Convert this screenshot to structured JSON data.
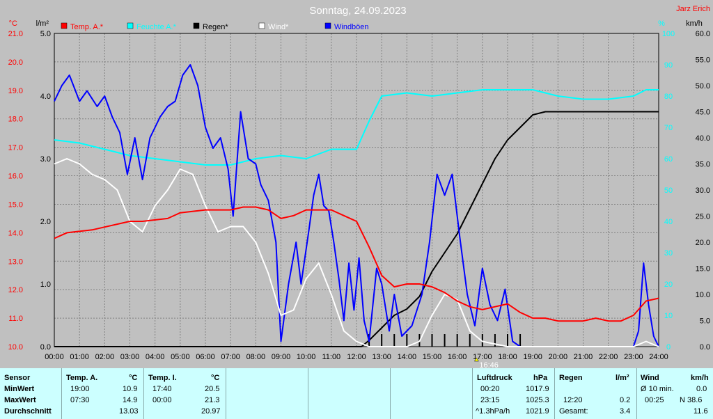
{
  "title": "Sonntag, 24.09.2023",
  "station": "Jarz Erich",
  "colors": {
    "temp_a": "#ff0000",
    "temp_i": "#00ffff",
    "rain": "#000000",
    "wind": "#ffffff",
    "gust": "#0000ff",
    "bg": "#c0c0c0",
    "grid": "#808080",
    "table_bg": "#ccffff"
  },
  "legend": [
    {
      "label": "Temp. A.*",
      "color": "#ff0000"
    },
    {
      "label": "Feuchte A.*",
      "color": "#00ffff"
    },
    {
      "label": "Regen*",
      "color": "#000000"
    },
    {
      "label": "Wind*",
      "color": "#ffffff"
    },
    {
      "label": "Windböen",
      "color": "#0000ff"
    }
  ],
  "axes": {
    "temp_unit": "°C",
    "rain_unit": "l/m²",
    "hum_unit": "%",
    "wind_unit": "km/h",
    "temp_ticks": [
      "21.0",
      "20.0",
      "19.0",
      "18.0",
      "17.0",
      "16.0",
      "15.0",
      "14.0",
      "13.0",
      "12.0",
      "11.0",
      "10.0"
    ],
    "rain_ticks": [
      "5.0",
      "4.0",
      "3.0",
      "2.0",
      "1.0",
      "0.0"
    ],
    "hum_ticks": [
      "100",
      "90",
      "80",
      "70",
      "60",
      "50",
      "40",
      "30",
      "20",
      "10",
      "0"
    ],
    "wind_ticks": [
      "60.0",
      "55.0",
      "50.0",
      "45.0",
      "40.0",
      "35.0",
      "30.0",
      "25.0",
      "20.0",
      "15.0",
      "10.0",
      "5.0",
      "0.0"
    ],
    "x_ticks": [
      "00:00",
      "01:00",
      "02:00",
      "03:00",
      "04:00",
      "05:00",
      "06:00",
      "07:00",
      "08:00",
      "09:00",
      "10:00",
      "11:00",
      "12:00",
      "13:00",
      "14:00",
      "15:00",
      "16:00",
      "17:00",
      "18:00",
      "19:00",
      "20:00",
      "21:00",
      "22:00",
      "23:00",
      "24:00"
    ],
    "marker_label": "16:46"
  },
  "chart_data": {
    "type": "line",
    "x_unit": "hour",
    "series": [
      {
        "name": "Temp. A.*",
        "unit": "°C",
        "points": [
          [
            0,
            13.8
          ],
          [
            0.5,
            14.0
          ],
          [
            1.5,
            14.1
          ],
          [
            2,
            14.2
          ],
          [
            3,
            14.4
          ],
          [
            3.5,
            14.4
          ],
          [
            4.5,
            14.5
          ],
          [
            5,
            14.7
          ],
          [
            6,
            14.8
          ],
          [
            7,
            14.8
          ],
          [
            7.5,
            14.9
          ],
          [
            8,
            14.9
          ],
          [
            8.5,
            14.8
          ],
          [
            9,
            14.5
          ],
          [
            9.5,
            14.6
          ],
          [
            10,
            14.8
          ],
          [
            10.5,
            14.8
          ],
          [
            11,
            14.8
          ],
          [
            11.5,
            14.6
          ],
          [
            12,
            14.4
          ],
          [
            12.5,
            13.5
          ],
          [
            13,
            12.5
          ],
          [
            13.5,
            12.1
          ],
          [
            14,
            12.2
          ],
          [
            14.5,
            12.2
          ],
          [
            15,
            12.1
          ],
          [
            15.5,
            11.9
          ],
          [
            16,
            11.6
          ],
          [
            16.5,
            11.4
          ],
          [
            17,
            11.3
          ],
          [
            17.5,
            11.4
          ],
          [
            18,
            11.5
          ],
          [
            18.5,
            11.2
          ],
          [
            19,
            11.0
          ],
          [
            19.5,
            11.0
          ],
          [
            20,
            10.9
          ],
          [
            21,
            10.9
          ],
          [
            21.5,
            11.0
          ],
          [
            22,
            10.9
          ],
          [
            22.5,
            10.9
          ],
          [
            23,
            11.1
          ],
          [
            23.5,
            11.6
          ],
          [
            24,
            11.7
          ]
        ]
      },
      {
        "name": "Feuchte A.*",
        "unit": "%",
        "points": [
          [
            0,
            66
          ],
          [
            1,
            65
          ],
          [
            2,
            63
          ],
          [
            3,
            61
          ],
          [
            4,
            60
          ],
          [
            5,
            59
          ],
          [
            6,
            58
          ],
          [
            7,
            58
          ],
          [
            8,
            60
          ],
          [
            9,
            61
          ],
          [
            10,
            60
          ],
          [
            11,
            63
          ],
          [
            12,
            63
          ],
          [
            12.5,
            72
          ],
          [
            13,
            80
          ],
          [
            14,
            81
          ],
          [
            15,
            80
          ],
          [
            16,
            81
          ],
          [
            17,
            82
          ],
          [
            18,
            82
          ],
          [
            19,
            82
          ],
          [
            20,
            80
          ],
          [
            21,
            79
          ],
          [
            22,
            79
          ],
          [
            23,
            80
          ],
          [
            23.5,
            82
          ],
          [
            24,
            82
          ]
        ]
      },
      {
        "name": "Regen*",
        "unit": "l/m²",
        "points": [
          [
            0,
            0
          ],
          [
            12.2,
            0
          ],
          [
            12.5,
            0.1
          ],
          [
            13,
            0.3
          ],
          [
            13.5,
            0.5
          ],
          [
            14,
            0.6
          ],
          [
            14.5,
            0.8
          ],
          [
            15,
            1.2
          ],
          [
            15.5,
            1.5
          ],
          [
            16,
            1.8
          ],
          [
            16.5,
            2.2
          ],
          [
            17,
            2.6
          ],
          [
            17.5,
            3.0
          ],
          [
            18,
            3.3
          ],
          [
            18.5,
            3.5
          ],
          [
            19,
            3.7
          ],
          [
            19.5,
            3.75
          ],
          [
            20,
            3.75
          ],
          [
            24,
            3.75
          ]
        ]
      },
      {
        "name": "Wind*",
        "unit": "km/h",
        "points": [
          [
            0,
            35
          ],
          [
            0.5,
            36
          ],
          [
            1,
            35
          ],
          [
            1.5,
            33
          ],
          [
            2,
            32
          ],
          [
            2.5,
            30
          ],
          [
            3,
            24
          ],
          [
            3.5,
            22
          ],
          [
            4,
            27
          ],
          [
            4.5,
            30
          ],
          [
            5,
            34
          ],
          [
            5.5,
            33
          ],
          [
            6,
            27
          ],
          [
            6.5,
            22
          ],
          [
            7,
            23
          ],
          [
            7.5,
            23
          ],
          [
            8,
            20
          ],
          [
            8.5,
            14
          ],
          [
            9,
            6
          ],
          [
            9.5,
            7
          ],
          [
            10,
            13
          ],
          [
            10.5,
            16
          ],
          [
            11,
            10
          ],
          [
            11.5,
            3
          ],
          [
            12,
            1
          ],
          [
            12.5,
            0
          ],
          [
            13,
            0
          ],
          [
            14,
            0
          ],
          [
            14.5,
            1
          ],
          [
            15,
            6
          ],
          [
            15.5,
            10
          ],
          [
            16,
            9
          ],
          [
            16.5,
            3
          ],
          [
            17,
            1
          ],
          [
            18,
            0
          ],
          [
            23,
            0
          ],
          [
            23.5,
            1
          ],
          [
            24,
            0
          ]
        ]
      },
      {
        "name": "Windböen",
        "unit": "km/h",
        "points": [
          [
            0,
            47
          ],
          [
            0.3,
            50
          ],
          [
            0.6,
            52
          ],
          [
            1,
            47
          ],
          [
            1.3,
            49
          ],
          [
            1.7,
            46
          ],
          [
            2,
            48
          ],
          [
            2.3,
            44
          ],
          [
            2.6,
            41
          ],
          [
            2.9,
            33
          ],
          [
            3.2,
            40
          ],
          [
            3.5,
            32
          ],
          [
            3.8,
            40
          ],
          [
            4.2,
            44
          ],
          [
            4.5,
            46
          ],
          [
            4.8,
            47
          ],
          [
            5.1,
            52
          ],
          [
            5.4,
            54
          ],
          [
            5.7,
            50
          ],
          [
            6,
            42
          ],
          [
            6.3,
            38
          ],
          [
            6.6,
            40
          ],
          [
            6.9,
            34
          ],
          [
            7.1,
            25
          ],
          [
            7.4,
            45
          ],
          [
            7.7,
            36
          ],
          [
            8,
            35
          ],
          [
            8.2,
            31
          ],
          [
            8.5,
            28
          ],
          [
            8.8,
            20
          ],
          [
            9.0,
            1
          ],
          [
            9.3,
            12
          ],
          [
            9.6,
            20
          ],
          [
            9.8,
            12
          ],
          [
            10.1,
            22
          ],
          [
            10.3,
            29
          ],
          [
            10.5,
            33
          ],
          [
            10.7,
            27
          ],
          [
            10.9,
            26
          ],
          [
            11.1,
            20
          ],
          [
            11.3,
            13
          ],
          [
            11.5,
            5
          ],
          [
            11.7,
            16
          ],
          [
            11.9,
            7
          ],
          [
            12.1,
            17
          ],
          [
            12.3,
            5
          ],
          [
            12.5,
            1
          ],
          [
            12.8,
            15
          ],
          [
            13.0,
            12
          ],
          [
            13.3,
            3
          ],
          [
            13.5,
            10
          ],
          [
            13.8,
            2
          ],
          [
            14.2,
            4
          ],
          [
            14.6,
            10
          ],
          [
            14.9,
            20
          ],
          [
            15.2,
            33
          ],
          [
            15.5,
            29
          ],
          [
            15.8,
            33
          ],
          [
            16.1,
            21
          ],
          [
            16.4,
            10
          ],
          [
            16.7,
            4
          ],
          [
            17.0,
            15
          ],
          [
            17.3,
            8
          ],
          [
            17.6,
            5
          ],
          [
            17.9,
            11
          ],
          [
            18.2,
            1
          ],
          [
            18.5,
            0
          ],
          [
            23,
            0
          ],
          [
            23.2,
            3
          ],
          [
            23.4,
            16
          ],
          [
            23.6,
            8
          ],
          [
            23.8,
            2
          ],
          [
            24,
            0
          ]
        ]
      }
    ]
  },
  "table": {
    "sensor_header": "Sensor",
    "row_labels": [
      "MinWert",
      "MaxWert",
      "Durchschnitt"
    ],
    "temp_a": {
      "header": "Temp. A.",
      "unit": "°C",
      "min_time": "19:00",
      "min_val": "10.9",
      "max_time": "07:30",
      "max_val": "14.9",
      "avg": "13.03"
    },
    "temp_i": {
      "header": "Temp. I.",
      "unit": "°C",
      "min_time": "17:40",
      "min_val": "20.5",
      "max_time": "00:00",
      "max_val": "21.3",
      "avg": "20.97"
    },
    "pressure": {
      "header": "Luftdruck",
      "unit": "hPa",
      "min_time": "00:20",
      "min_val": "1017.9",
      "max_time": "23:15",
      "max_val": "1025.3",
      "trend": "^1.3hPa/h",
      "avg": "1021.9"
    },
    "rain": {
      "header": "Regen",
      "unit": "l/m²",
      "max_time": "12:20",
      "max_val": "0.2",
      "total_label": "Gesamt:",
      "total": "3.4"
    },
    "wind": {
      "header": "Wind",
      "unit": "km/h",
      "avg_label": "Ø 10 min.",
      "avg_val": "0.0",
      "max_time": "00:25",
      "max_val": "N 38.6",
      "mean": "11.6"
    }
  }
}
